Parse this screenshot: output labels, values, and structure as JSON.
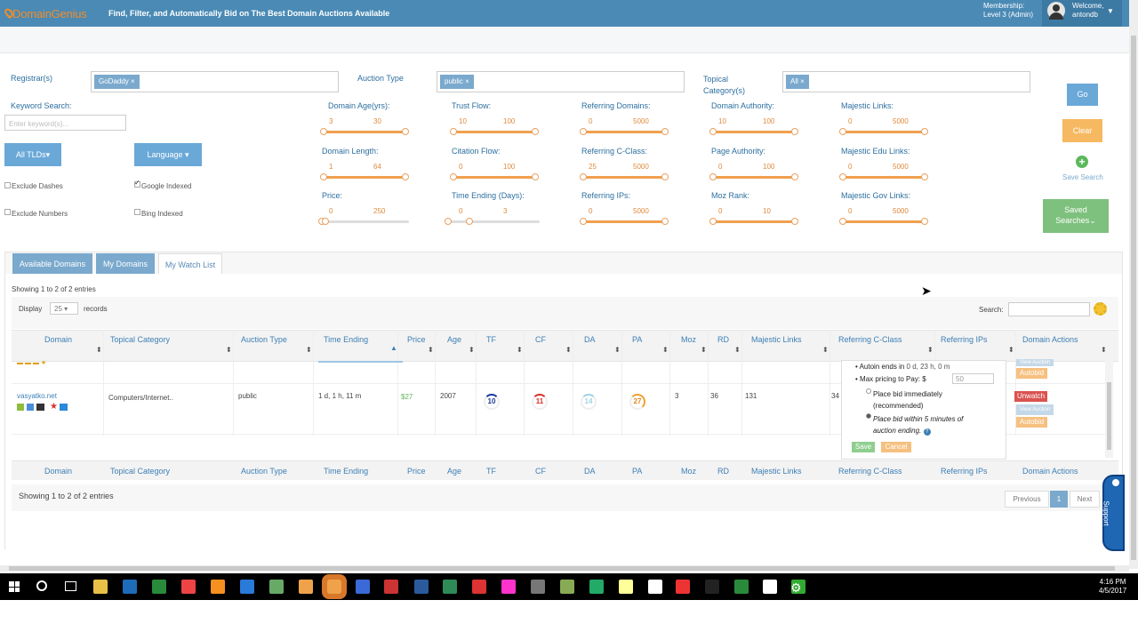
{
  "header": {
    "logo": "DomainGenius",
    "tagline": "Find, Filter, and Automatically Bid on The Best Domain Auctions Available",
    "membership_l1": "Membership:",
    "membership_l2": "Level 3 (Admin)",
    "welcome_l1": "Welcome,",
    "welcome_l2": "antondb"
  },
  "filters": {
    "registrar_label": "Registrar(s)",
    "registrar_tag": "GoDaddy",
    "auction_type_label": "Auction Type",
    "auction_type_tag": "public",
    "topical_label_1": "Topical",
    "topical_label_2": "Category(s)",
    "topical_tag": "All",
    "keyword_label": "Keyword Search:",
    "keyword_placeholder": "Enter keyword(s)...",
    "all_tlds": "All TLDs",
    "language": "Language",
    "exclude_dashes": "Exclude Dashes",
    "exclude_numbers": "Exclude Numbers",
    "google_indexed": "Google Indexed",
    "bing_indexed": "Bing Indexed",
    "ranges": [
      {
        "label": "Domain Age(yrs):",
        "min": "3",
        "max": "30"
      },
      {
        "label": "Trust Flow:",
        "min": "10",
        "max": "100"
      },
      {
        "label": "Referring Domains:",
        "min": "0",
        "max": "5000"
      },
      {
        "label": "Domain Authority:",
        "min": "10",
        "max": "100"
      },
      {
        "label": "Majestic Links:",
        "min": "0",
        "max": "5000"
      },
      {
        "label": "Domain Length:",
        "min": "1",
        "max": "64"
      },
      {
        "label": "Citation Flow:",
        "min": "0",
        "max": "100"
      },
      {
        "label": "Referring C-Class:",
        "min": "25",
        "max": "5000"
      },
      {
        "label": "Page Authority:",
        "min": "0",
        "max": "100"
      },
      {
        "label": "Majestic Edu Links:",
        "min": "0",
        "max": "5000"
      },
      {
        "label": "Price:",
        "min": "0",
        "max": "250"
      },
      {
        "label": "Time Ending (Days):",
        "min": "0",
        "max": "3"
      },
      {
        "label": "Referring IPs:",
        "min": "0",
        "max": "5000"
      },
      {
        "label": "Moz Rank:",
        "min": "0",
        "max": "10"
      },
      {
        "label": "Majestic Gov Links:",
        "min": "0",
        "max": "5000"
      }
    ],
    "go": "Go",
    "clear": "Clear",
    "save_search": "Save Search",
    "saved_searches_1": "Saved",
    "saved_searches_2": "Searches"
  },
  "tabs": [
    "Available Domains",
    "My Domains",
    "My Watch List"
  ],
  "table": {
    "showing_top": "Showing 1 to 2 of 2 entries",
    "display": "Display",
    "records_value": "25",
    "records": "records",
    "search_label": "Search:",
    "columns": [
      "Domain",
      "Topical Category",
      "Auction Type",
      "Time Ending",
      "Price",
      "Age",
      "TF",
      "CF",
      "DA",
      "PA",
      "Moz",
      "RD",
      "Majestic Links",
      "Referring C-Class",
      "Referring IPs",
      "Domain Actions"
    ],
    "row": {
      "domain": "vasyatko.net",
      "category": "Computers/Internet..",
      "auction": "public",
      "time": "1 d, 1 h, 11 m",
      "price": "$27",
      "age": "2007",
      "tf": "10",
      "cf": "11",
      "da": "14",
      "pa": "27",
      "moz": "3",
      "rd": "36",
      "majestic": "131",
      "cclass": "34"
    },
    "showing_bottom": "Showing 1 to 2 of 2 entries",
    "prev": "Previous",
    "page": "1",
    "next": "Next"
  },
  "popup": {
    "ends": "Autoin ends in",
    "ends_val": "0 d, 23 h, 0 m",
    "max_label": "Max pricing to Pay: $",
    "max_value": "50",
    "opt1_l1": "Place bid immediately",
    "opt1_l2": "(recommended)",
    "opt2_l1": "Place bid within 5 minutes of",
    "opt2_l2": "auction ending.",
    "save": "Save",
    "cancel": "Cancel"
  },
  "actions": {
    "unwatch": "Unwatch",
    "view_auction": "View Auction",
    "autobid": "Autobid"
  },
  "support": "Support",
  "taskbar": {
    "time": "4:16 PM",
    "date": "4/5/2017"
  }
}
